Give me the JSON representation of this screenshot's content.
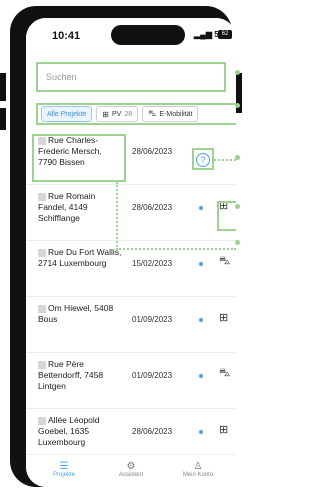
{
  "status": {
    "time": "10:41",
    "signal": "5G",
    "battery": "62"
  },
  "search": {
    "placeholder": "Suchen"
  },
  "tabs": [
    {
      "label": "Alle Projekte",
      "icon": "",
      "active": true
    },
    {
      "label": "PV",
      "count": "28",
      "icon": "solar-panel-icon",
      "active": false
    },
    {
      "label": "E-Mobilität",
      "icon": "car-icon",
      "active": false
    }
  ],
  "projects": [
    {
      "address": "Rue Charles-Frederic Mersch, 7790 Bissen",
      "date": "28/06/2023",
      "type_icon": "question-circle-icon"
    },
    {
      "address": "Rue Romain Fandel, 4149 Schifflange",
      "date": "28/06/2023",
      "type_icon": "solar-panel-icon"
    },
    {
      "address": "Rue Du Fort Wallis, 2714 Luxembourg",
      "date": "15/02/2023",
      "type_icon": "car-icon"
    },
    {
      "address": "Om Hiewel, 5408 Bous",
      "date": "01/09/2023",
      "type_icon": "solar-panel-icon"
    },
    {
      "address": "Rue Père Bettendorff, 7458 Lintgen",
      "date": "01/09/2023",
      "type_icon": "car-icon"
    },
    {
      "address": "Allée Léopold Goebel, 1635 Luxembourg",
      "date": "28/06/2023",
      "type_icon": "solar-panel-icon"
    }
  ],
  "bottom_nav": [
    {
      "label": "Projekte",
      "icon": "list-icon",
      "active": true
    },
    {
      "label": "Assistent",
      "icon": "gear-icon",
      "active": false
    },
    {
      "label": "Mein Konto",
      "icon": "user-icon",
      "active": false
    }
  ],
  "colors": {
    "accent": "#4aa3f0",
    "highlight": "#9bd38f"
  }
}
